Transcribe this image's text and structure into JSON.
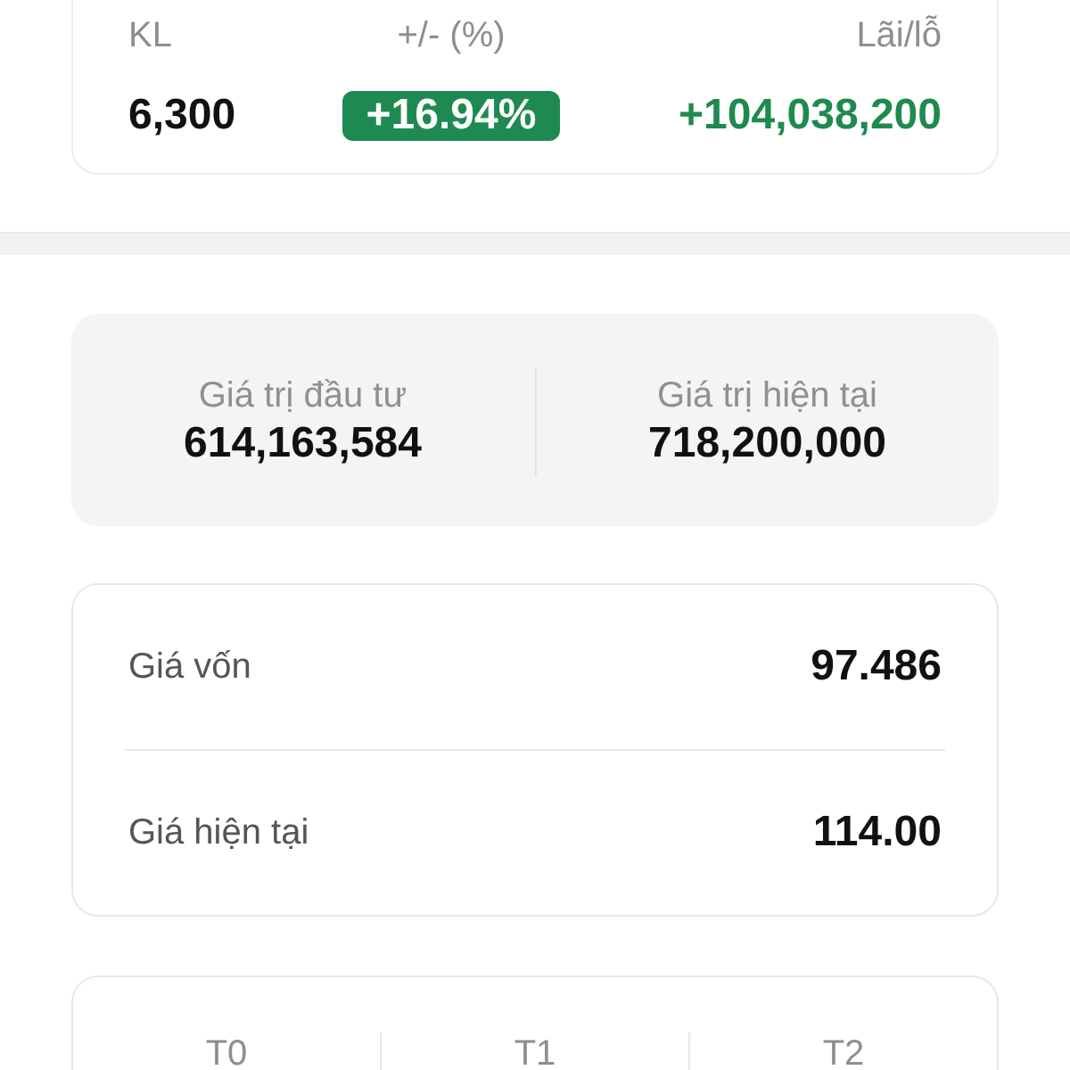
{
  "summary": {
    "columns": [
      {
        "label": "KL",
        "value": "6,300",
        "kind": "plain"
      },
      {
        "label": "+/- (%)",
        "value": "+16.94%",
        "kind": "badge"
      },
      {
        "label": "Lãi/lỗ",
        "value": "+104,038,200",
        "kind": "gain"
      }
    ]
  },
  "value_card": {
    "items": [
      {
        "label": "Giá trị đầu tư",
        "value": "614,163,584"
      },
      {
        "label": "Giá trị hiện tại",
        "value": "718,200,000"
      }
    ]
  },
  "price_card": {
    "rows": [
      {
        "label": "Giá vốn",
        "value": "97.486"
      },
      {
        "label": "Giá hiện tại",
        "value": "114.00"
      }
    ]
  },
  "settlement_card": {
    "columns": [
      "T0",
      "T1",
      "T2"
    ]
  }
}
